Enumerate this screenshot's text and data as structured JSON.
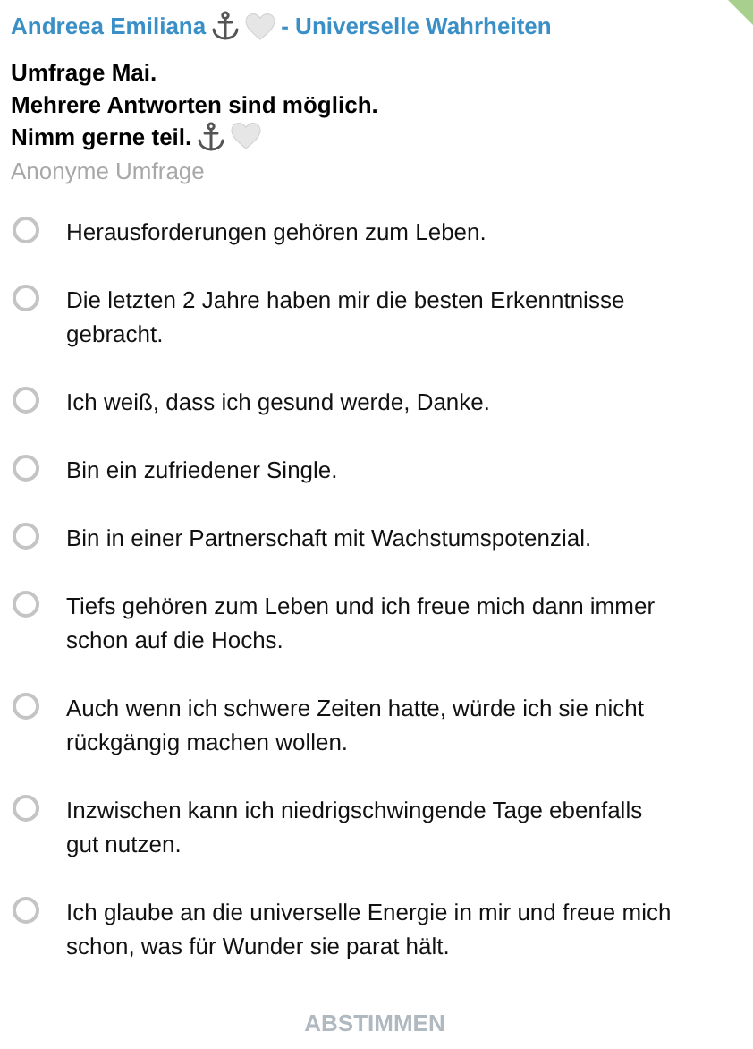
{
  "header": {
    "sender": "Andreea Emiliana",
    "channel": "- Universelle Wahrheiten"
  },
  "question": {
    "lines": [
      "Umfrage Mai.",
      "Mehrere Antworten sind möglich.",
      "Nimm gerne teil."
    ]
  },
  "poll_type": "Anonyme Umfrage",
  "options": [
    {
      "label": "Herausforderungen gehören zum Leben.",
      "selected": false
    },
    {
      "label": "Die letzten 2 Jahre haben mir die besten Erkenntnisse gebracht.",
      "selected": false
    },
    {
      "label": "Ich weiß, dass ich gesund werde, Danke.",
      "selected": false
    },
    {
      "label": "Bin ein zufriedener Single.",
      "selected": false
    },
    {
      "label": "Bin in einer Partnerschaft mit Wachstumspotenzial.",
      "selected": false
    },
    {
      "label": "Tiefs gehören zum Leben und ich freue mich dann immer schon auf die Hochs.",
      "selected": false
    },
    {
      "label": "Auch wenn ich schwere Zeiten hatte, würde ich sie nicht rückgängig machen wollen.",
      "selected": false
    },
    {
      "label": "Inzwischen kann ich niedrigschwingende Tage ebenfalls gut nutzen.",
      "selected": false
    },
    {
      "label": "Ich glaube an die universelle Energie in mir und freue mich schon, was für Wunder sie parat hält.",
      "selected": false
    }
  ],
  "vote_button": {
    "label": "ABSTIMMEN",
    "disabled": true
  }
}
